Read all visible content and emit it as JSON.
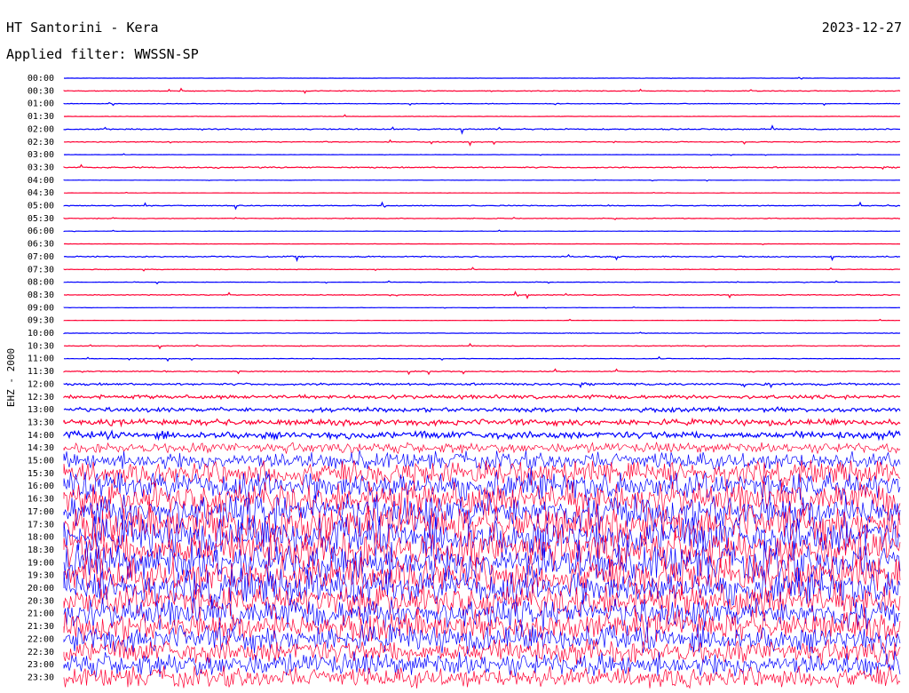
{
  "header": {
    "station": "HT Santorini - Kera",
    "date": "2023-12-27",
    "filter": "Applied filter: WWSSN-SP"
  },
  "side_label": "EHZ - 2000",
  "colors": {
    "even_trace": "#0000ff",
    "odd_trace": "#ff0033",
    "background": "#ffffff",
    "text": "#000000"
  },
  "chart_data": {
    "type": "line",
    "subtype": "helicorder",
    "rows": [
      {
        "label": "00:00",
        "level": 0.2
      },
      {
        "label": "00:30",
        "level": 0.5
      },
      {
        "label": "01:00",
        "level": 0.4
      },
      {
        "label": "01:30",
        "level": 0.3
      },
      {
        "label": "02:00",
        "level": 0.8
      },
      {
        "label": "02:30",
        "level": 0.6
      },
      {
        "label": "03:00",
        "level": 0.2
      },
      {
        "label": "03:30",
        "level": 0.8
      },
      {
        "label": "04:00",
        "level": 0.2
      },
      {
        "label": "04:30",
        "level": 0.2
      },
      {
        "label": "05:00",
        "level": 0.6
      },
      {
        "label": "05:30",
        "level": 0.5
      },
      {
        "label": "06:00",
        "level": 0.2
      },
      {
        "label": "06:30",
        "level": 0.2
      },
      {
        "label": "07:00",
        "level": 0.8
      },
      {
        "label": "07:30",
        "level": 0.4
      },
      {
        "label": "08:00",
        "level": 0.3
      },
      {
        "label": "08:30",
        "level": 0.6
      },
      {
        "label": "09:00",
        "level": 0.2
      },
      {
        "label": "09:30",
        "level": 0.2
      },
      {
        "label": "10:00",
        "level": 0.4
      },
      {
        "label": "10:30",
        "level": 0.5
      },
      {
        "label": "11:00",
        "level": 0.4
      },
      {
        "label": "11:30",
        "level": 0.7
      },
      {
        "label": "12:00",
        "level": 1.5
      },
      {
        "label": "12:30",
        "level": 2.5
      },
      {
        "label": "13:00",
        "level": 3.0
      },
      {
        "label": "13:30",
        "level": 4.0
      },
      {
        "label": "14:00",
        "level": 5.0
      },
      {
        "label": "14:30",
        "level": 7.0
      },
      {
        "label": "15:00",
        "level": 12.0
      },
      {
        "label": "15:30",
        "level": 16.0
      },
      {
        "label": "16:00",
        "level": 20.0
      },
      {
        "label": "16:30",
        "level": 22.0
      },
      {
        "label": "17:00",
        "level": 24.0
      },
      {
        "label": "17:30",
        "level": 26.0
      },
      {
        "label": "18:00",
        "level": 26.0
      },
      {
        "label": "18:30",
        "level": 26.0
      },
      {
        "label": "19:00",
        "level": 26.0
      },
      {
        "label": "19:30",
        "level": 25.0
      },
      {
        "label": "20:00",
        "level": 24.0
      },
      {
        "label": "20:30",
        "level": 22.0
      },
      {
        "label": "21:00",
        "level": 20.0
      },
      {
        "label": "21:30",
        "level": 20.0
      },
      {
        "label": "22:00",
        "level": 18.0
      },
      {
        "label": "22:30",
        "level": 16.0
      },
      {
        "label": "23:00",
        "level": 16.0
      },
      {
        "label": "23:30",
        "level": 14.0
      }
    ]
  }
}
